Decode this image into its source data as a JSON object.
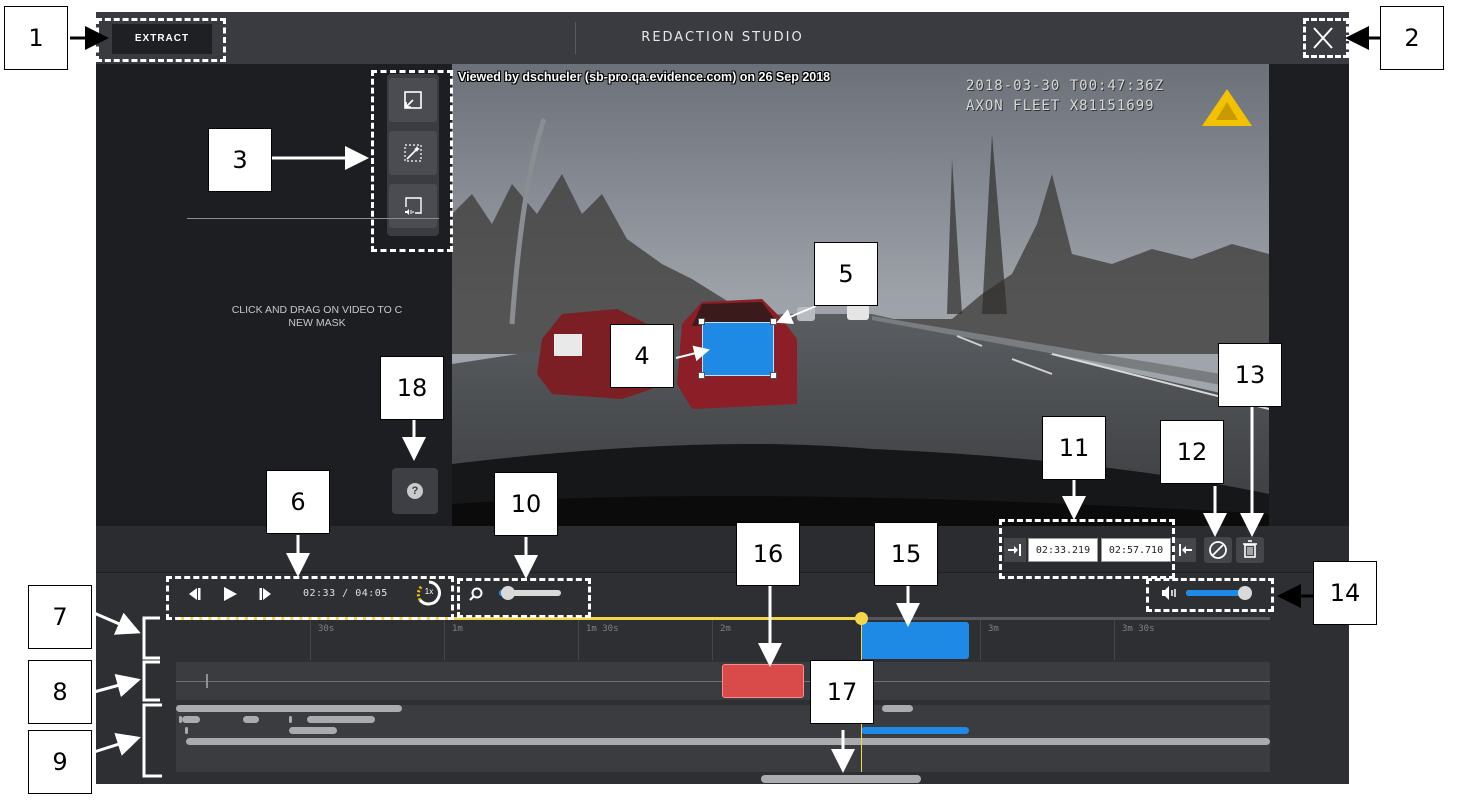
{
  "header": {
    "title": "REDACTION STUDIO",
    "extract_label": "EXTRACT",
    "close_icon": "close-icon"
  },
  "side_panel": {
    "hint_line1": "CLICK AND DRAG ON VIDEO TO C",
    "hint_line2": "NEW MASK",
    "tools": [
      "cursor-select-icon",
      "auto-detect-icon",
      "audio-mask-icon"
    ],
    "help_label": "?"
  },
  "video": {
    "watermark": "Viewed by dschueler (sb-pro.qa.evidence.com) on 26 Sep 2018",
    "stamp_line1": "2018-03-30 T00:47:36Z",
    "stamp_line2": "AXON FLEET  X81151699",
    "logo": "axon-logo"
  },
  "mask_editor": {
    "start_time": "02:33.219",
    "end_time": "02:57.710"
  },
  "transport": {
    "current_time": "02:33",
    "separator": "/",
    "duration": "04:05",
    "speed": "1x",
    "zoom_level": 0.15,
    "volume_level": 0.95
  },
  "timeline": {
    "ticks": [
      "30s",
      "1m",
      "1m 30s",
      "2m",
      "3m",
      "3m 30s"
    ]
  },
  "callouts": [
    "1",
    "2",
    "3",
    "4",
    "5",
    "6",
    "7",
    "8",
    "9",
    "10",
    "11",
    "12",
    "13",
    "14",
    "15",
    "16",
    "17",
    "18"
  ],
  "colors": {
    "accent_blue": "#1f8ae6",
    "playhead_yellow": "#f2d64b",
    "audio_mask_red": "#d94a4a",
    "background": "#2d2f33"
  }
}
